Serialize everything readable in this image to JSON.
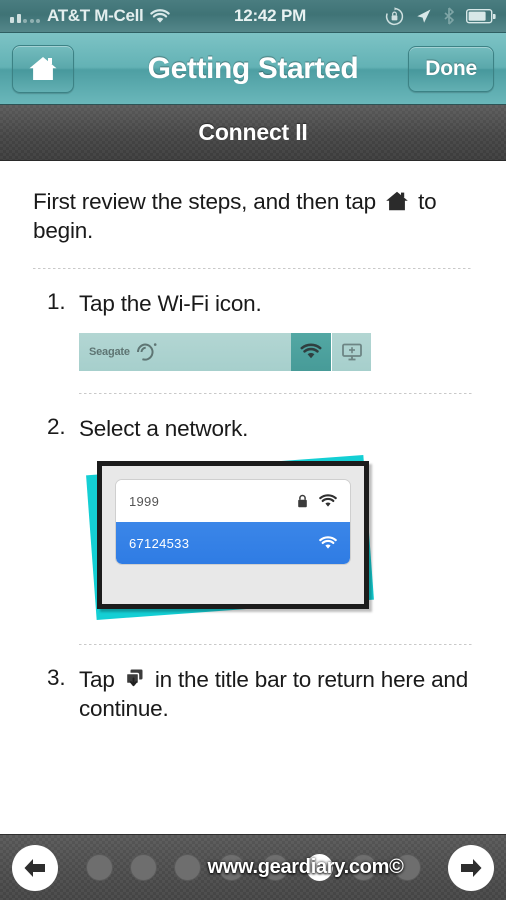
{
  "status_bar": {
    "carrier": "AT&T M-Cell",
    "time": "12:42 PM",
    "signal_icon": "signal-bars-icon",
    "wifi_icon": "wifi-icon",
    "rotation_lock_icon": "rotation-lock-icon",
    "location_icon": "location-arrow-icon",
    "bluetooth_icon": "bluetooth-icon",
    "battery_icon": "battery-icon"
  },
  "nav_bar": {
    "title": "Getting Started",
    "home_icon": "home-icon",
    "done_label": "Done"
  },
  "subtitle_bar": {
    "title": "Connect II"
  },
  "content": {
    "intro_before": "First review the steps, and then tap",
    "intro_icon": "home-icon",
    "intro_after": "to begin.",
    "steps": [
      {
        "number": "1.",
        "text": "Tap the Wi-Fi icon.",
        "figure": {
          "type": "seagate-bar",
          "brand": "Seagate",
          "brand_logo_icon": "seagate-swirl-icon",
          "wifi_icon": "wifi-icon",
          "display_icon": "display-screen-icon"
        }
      },
      {
        "number": "2.",
        "text": "Select a network.",
        "figure": {
          "type": "network-picker",
          "networks": [
            {
              "ssid": "1999",
              "secured": true,
              "lock_icon": "lock-icon",
              "wifi_icon": "wifi-icon",
              "selected": false
            },
            {
              "ssid": "67124533",
              "secured": false,
              "wifi_icon": "wifi-icon",
              "selected": true
            }
          ]
        }
      },
      {
        "number": "3.",
        "text_before": "Tap",
        "inline_icon": "return-to-app-icon",
        "text_after": "in the title bar to return here and continue."
      }
    ]
  },
  "toolbar": {
    "back_icon": "arrow-left-icon",
    "forward_icon": "arrow-right-icon",
    "watermark": "www.geardiary.com©",
    "page_dots": [
      {
        "active": false
      },
      {
        "active": false
      },
      {
        "active": false
      },
      {
        "active": false
      },
      {
        "active": false
      },
      {
        "active": true
      },
      {
        "active": false
      },
      {
        "active": false
      }
    ]
  },
  "colors": {
    "nav_teal": "#63b2b5",
    "status_teal": "#3f7376",
    "cyan_accent": "#14cfd4",
    "selected_blue": "#2f7ce4",
    "seagate_mint": "#a6cfcc",
    "toolbar_gray": "#4b4b4b"
  }
}
